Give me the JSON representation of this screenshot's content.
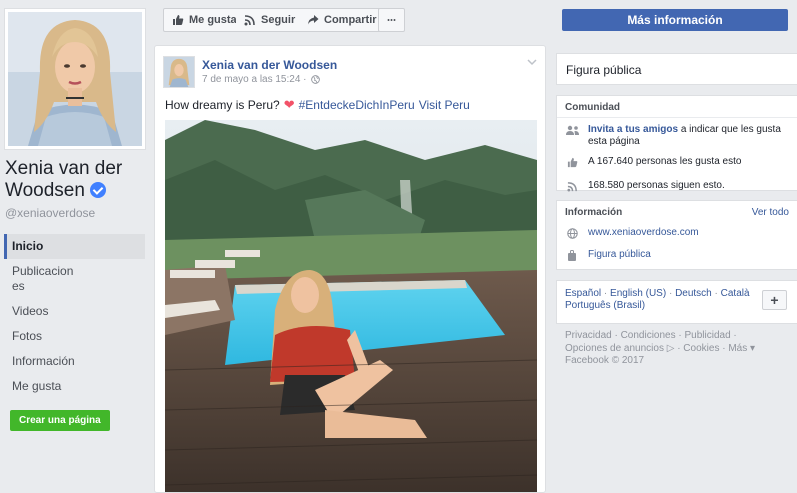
{
  "profile": {
    "name": "Xenia van der Woodsen",
    "handle": "@xeniaoverdose"
  },
  "left_nav": {
    "items": [
      {
        "label": "Inicio"
      },
      {
        "label": "Publicaciones"
      },
      {
        "label": "Videos"
      },
      {
        "label": "Fotos"
      },
      {
        "label": "Información"
      },
      {
        "label": "Me gusta"
      }
    ],
    "create_page": "Crear una página"
  },
  "actions": {
    "like": "Me gusta",
    "follow": "Seguir",
    "share": "Compartir",
    "more_info": "Más información"
  },
  "post": {
    "author": "Xenia van der Woodsen",
    "time": "7 de mayo a las 15:24 ·",
    "text": "How dreamy is Peru?",
    "hashtag": "#EntdeckeDichInPeru",
    "link": "Visit Peru"
  },
  "sidebar": {
    "category": "Figura pública",
    "community": {
      "title": "Comunidad",
      "invite_link": "Invita a tus amigos",
      "invite_rest": "a indicar que les gusta esta página",
      "likes": "A 167.640 personas les gusta esto",
      "follows": "168.580 personas siguen esto."
    },
    "info": {
      "title": "Información",
      "see_all": "Ver todo",
      "website": "www.xeniaoverdose.com",
      "category": "Figura pública"
    },
    "languages": {
      "items": [
        "Español",
        "English (US)",
        "Deutsch",
        "Català",
        "Português (Brasil)"
      ],
      "add": "+"
    },
    "footer": {
      "line1": "Privacidad · Condiciones · Publicidad ·",
      "line2": "Opciones de anuncios ▷ · Cookies · Más ▾",
      "line3": "Facebook © 2017"
    }
  },
  "colors": {
    "brand_blue": "#4267b2",
    "link_blue": "#365899",
    "green": "#42b72a",
    "verified": "#4080ff",
    "heart": "#f25268"
  }
}
